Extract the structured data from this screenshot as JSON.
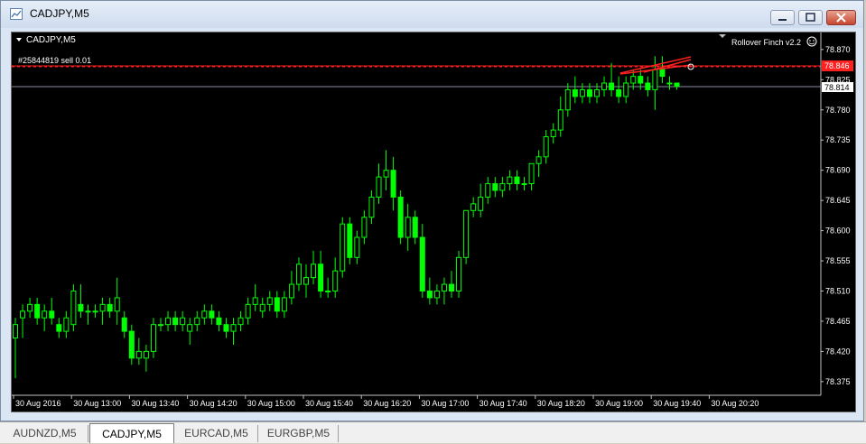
{
  "window": {
    "title": "CADJPY,M5",
    "chart_symbol": "CADJPY,M5",
    "indicator_label": "Rollover Finch v2.2",
    "order_label": "#25844819 sell 0.01"
  },
  "price_axis": {
    "labels": [
      "78.870",
      "78.825",
      "78.780",
      "78.735",
      "78.690",
      "78.645",
      "78.600",
      "78.555",
      "78.510",
      "78.465",
      "78.420",
      "78.375"
    ],
    "order_price": "78.846",
    "current_price": "78.814"
  },
  "time_axis": {
    "labels": [
      "30 Aug 2016",
      "30 Aug 13:00",
      "30 Aug 13:40",
      "30 Aug 14:20",
      "30 Aug 15:00",
      "30 Aug 15:40",
      "30 Aug 16:20",
      "30 Aug 17:00",
      "30 Aug 17:40",
      "30 Aug 18:20",
      "30 Aug 19:00",
      "30 Aug 19:40",
      "30 Aug 20:20"
    ]
  },
  "tabs": [
    {
      "label": "AUDNZD,M5",
      "active": false
    },
    {
      "label": "CADJPY,M5",
      "active": true
    },
    {
      "label": "EURCAD,M5",
      "active": false
    },
    {
      "label": "EURGBP,M5",
      "active": false
    }
  ],
  "colors": {
    "background": "#000000",
    "bull": "#00ff00",
    "order_line": "#ff2020",
    "bid_line": "#a0a0c0",
    "label_bg_order": "#ff2020",
    "label_bg_bid": "#ffffff"
  },
  "chart_data": {
    "type": "candlestick",
    "ylim": [
      78.36,
      78.89
    ],
    "candles": [
      [
        78.44,
        78.47,
        78.38,
        78.46
      ],
      [
        78.47,
        78.49,
        78.44,
        78.48
      ],
      [
        78.48,
        78.5,
        78.47,
        78.49
      ],
      [
        78.49,
        78.5,
        78.46,
        78.47
      ],
      [
        78.47,
        78.49,
        78.45,
        78.48
      ],
      [
        78.48,
        78.5,
        78.46,
        78.47
      ],
      [
        78.46,
        78.47,
        78.44,
        78.45
      ],
      [
        78.45,
        78.48,
        78.44,
        78.47
      ],
      [
        78.46,
        78.52,
        78.45,
        78.51
      ],
      [
        78.49,
        78.52,
        78.47,
        78.48
      ],
      [
        78.48,
        78.49,
        78.46,
        78.48
      ],
      [
        78.48,
        78.49,
        78.47,
        78.48
      ],
      [
        78.48,
        78.5,
        78.46,
        78.49
      ],
      [
        78.49,
        78.5,
        78.47,
        78.48
      ],
      [
        78.48,
        78.53,
        78.46,
        78.5
      ],
      [
        78.47,
        78.48,
        78.44,
        78.45
      ],
      [
        78.45,
        78.46,
        78.4,
        78.41
      ],
      [
        78.41,
        78.44,
        78.4,
        78.42
      ],
      [
        78.41,
        78.43,
        78.39,
        78.42
      ],
      [
        78.42,
        78.47,
        78.41,
        78.46
      ],
      [
        78.46,
        78.47,
        78.45,
        78.46
      ],
      [
        78.46,
        78.48,
        78.45,
        78.47
      ],
      [
        78.47,
        78.48,
        78.45,
        78.46
      ],
      [
        78.46,
        78.48,
        78.45,
        78.47
      ],
      [
        78.45,
        78.47,
        78.43,
        78.46
      ],
      [
        78.46,
        78.48,
        78.45,
        78.47
      ],
      [
        78.47,
        78.49,
        78.46,
        78.48
      ],
      [
        78.48,
        78.49,
        78.46,
        78.47
      ],
      [
        78.47,
        78.48,
        78.45,
        78.46
      ],
      [
        78.46,
        78.47,
        78.44,
        78.45
      ],
      [
        78.45,
        78.47,
        78.43,
        78.46
      ],
      [
        78.46,
        78.48,
        78.45,
        78.47
      ],
      [
        78.47,
        78.5,
        78.46,
        78.49
      ],
      [
        78.49,
        78.52,
        78.48,
        78.5
      ],
      [
        78.48,
        78.5,
        78.47,
        78.49
      ],
      [
        78.49,
        78.51,
        78.48,
        78.5
      ],
      [
        78.5,
        78.51,
        78.47,
        78.48
      ],
      [
        78.48,
        78.51,
        78.47,
        78.5
      ],
      [
        78.5,
        78.54,
        78.49,
        78.52
      ],
      [
        78.52,
        78.56,
        78.51,
        78.55
      ],
      [
        78.52,
        78.55,
        78.5,
        78.53
      ],
      [
        78.53,
        78.57,
        78.52,
        78.55
      ],
      [
        78.55,
        78.57,
        78.5,
        78.51
      ],
      [
        78.51,
        78.53,
        78.5,
        78.51
      ],
      [
        78.51,
        78.56,
        78.5,
        78.54
      ],
      [
        78.54,
        78.62,
        78.53,
        78.61
      ],
      [
        78.61,
        78.62,
        78.55,
        78.56
      ],
      [
        78.56,
        78.6,
        78.55,
        78.59
      ],
      [
        78.59,
        78.63,
        78.58,
        78.62
      ],
      [
        78.62,
        78.66,
        78.61,
        78.65
      ],
      [
        78.65,
        78.7,
        78.64,
        78.68
      ],
      [
        78.68,
        78.72,
        78.66,
        78.69
      ],
      [
        78.69,
        78.71,
        78.63,
        78.65
      ],
      [
        78.65,
        78.66,
        78.58,
        78.59
      ],
      [
        78.59,
        78.64,
        78.57,
        78.62
      ],
      [
        78.62,
        78.63,
        78.58,
        78.59
      ],
      [
        78.59,
        78.61,
        78.5,
        78.51
      ],
      [
        78.51,
        78.53,
        78.49,
        78.5
      ],
      [
        78.5,
        78.52,
        78.49,
        78.51
      ],
      [
        78.51,
        78.53,
        78.49,
        78.52
      ],
      [
        78.52,
        78.54,
        78.5,
        78.51
      ],
      [
        78.51,
        78.57,
        78.5,
        78.56
      ],
      [
        78.56,
        78.62,
        78.55,
        78.63
      ],
      [
        78.63,
        78.65,
        78.62,
        78.64
      ],
      [
        78.63,
        78.67,
        78.62,
        78.65
      ],
      [
        78.65,
        78.68,
        78.64,
        78.67
      ],
      [
        78.67,
        78.68,
        78.65,
        78.66
      ],
      [
        78.66,
        78.68,
        78.65,
        78.67
      ],
      [
        78.67,
        78.69,
        78.66,
        78.68
      ],
      [
        78.68,
        78.69,
        78.66,
        78.67
      ],
      [
        78.67,
        78.68,
        78.66,
        78.67
      ],
      [
        78.67,
        78.7,
        78.66,
        78.7
      ],
      [
        78.7,
        78.72,
        78.68,
        78.71
      ],
      [
        78.71,
        78.75,
        78.7,
        78.74
      ],
      [
        78.74,
        78.76,
        78.73,
        78.75
      ],
      [
        78.75,
        78.8,
        78.74,
        78.78
      ],
      [
        78.78,
        78.82,
        78.77,
        78.81
      ],
      [
        78.81,
        78.83,
        78.79,
        78.8
      ],
      [
        78.8,
        78.82,
        78.79,
        78.81
      ],
      [
        78.81,
        78.82,
        78.79,
        78.8
      ],
      [
        78.8,
        78.82,
        78.79,
        78.81
      ],
      [
        78.81,
        78.83,
        78.8,
        78.82
      ],
      [
        78.82,
        78.85,
        78.8,
        78.81
      ],
      [
        78.81,
        78.83,
        78.79,
        78.8
      ],
      [
        78.8,
        78.83,
        78.79,
        78.82
      ],
      [
        78.82,
        78.84,
        78.81,
        78.83
      ],
      [
        78.83,
        78.84,
        78.81,
        78.82
      ],
      [
        78.82,
        78.83,
        78.8,
        78.81
      ],
      [
        78.81,
        78.86,
        78.78,
        78.84
      ],
      [
        78.84,
        78.86,
        78.82,
        78.83
      ],
      [
        78.82,
        78.83,
        78.81,
        78.82
      ],
      [
        78.82,
        78.82,
        78.81,
        78.815
      ]
    ]
  }
}
